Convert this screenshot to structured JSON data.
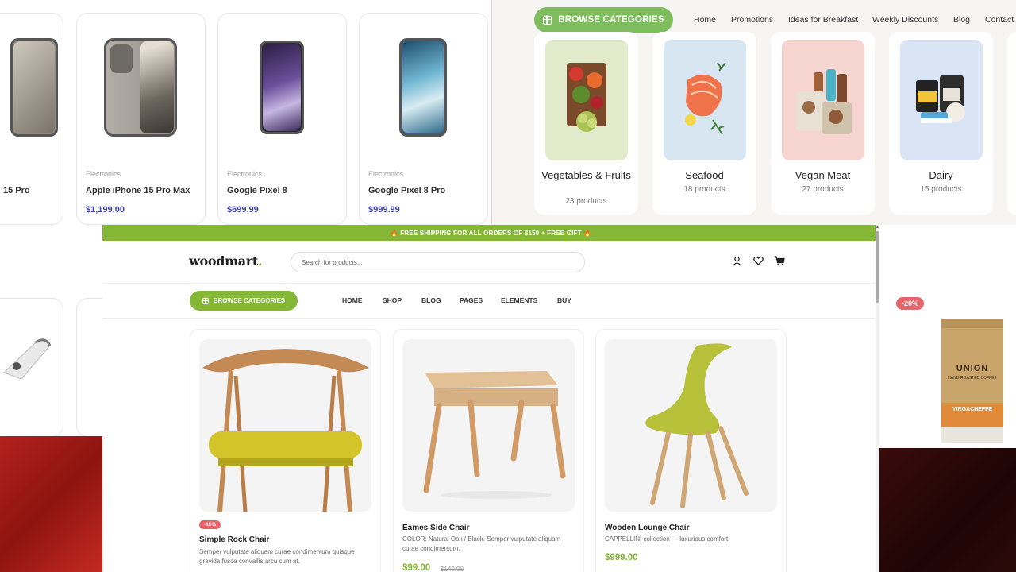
{
  "phones": {
    "items": [
      {
        "category": "",
        "name": "15 Pro",
        "price": ""
      },
      {
        "category": "Electronics",
        "name": "Apple iPhone 15 Pro Max",
        "price": "$1,199.00"
      },
      {
        "category": "Electronics",
        "name": "Google Pixel 8",
        "price": "$699.99"
      },
      {
        "category": "Electronics",
        "name": "Google Pixel 8 Pro",
        "price": "$999.99"
      }
    ]
  },
  "grocery": {
    "browse_label": "BROWSE CATEGORIES",
    "nav": [
      "Home",
      "Promotions",
      "Ideas for Breakfast",
      "Weekly Discounts",
      "Blog",
      "Contact"
    ],
    "categories": [
      {
        "title": "Vegetables & Fruits",
        "count": "23 products",
        "bg": "#e1ebcc"
      },
      {
        "title": "Seafood",
        "count": "18 products",
        "bg": "#d8e6f2"
      },
      {
        "title": "Vegan Meat",
        "count": "27 products",
        "bg": "#f6d5d1"
      },
      {
        "title": "Dairy",
        "count": "15 products",
        "bg": "#d9e5f4"
      }
    ]
  },
  "woodmart": {
    "banner": "🔥 FREE SHIPPING FOR ALL ORDERS OF $150 + FREE GIFT 🔥",
    "logo": "woodmart",
    "logo_dot": ".",
    "search_placeholder": "Search for products...",
    "browse_label": "BROWSE CATEGORIES",
    "nav": [
      "HOME",
      "SHOP",
      "BLOG",
      "PAGES",
      "ELEMENTS",
      "BUY"
    ],
    "products": [
      {
        "badge": "-15%",
        "title": "Simple Rock Chair",
        "desc": "Semper vulputate aliquam curae condimentum quisque gravida fusce convallis arcu cum at.",
        "price": "",
        "old_price": ""
      },
      {
        "badge": "",
        "title": "Eames Side Chair",
        "desc": "COLOR: Natural Oak / Black. Semper vulputate aliquam curae condimentum.",
        "price": "$99.00",
        "old_price": "$149.00"
      },
      {
        "badge": "",
        "title": "Wooden Lounge Chair",
        "desc": "CAPPELLINI collection — luxurious comfort.",
        "price": "$999.00",
        "old_price": ""
      }
    ],
    "colors": {
      "accent": "#83b735"
    }
  },
  "right_strip": {
    "badge": "-20%",
    "brand": "UNION",
    "sub": "HAND-ROASTED COFFEE",
    "variant": "YIRGACHEFFE"
  },
  "icons": [
    "grid-icon",
    "user-icon",
    "heart-icon",
    "cart-icon"
  ]
}
